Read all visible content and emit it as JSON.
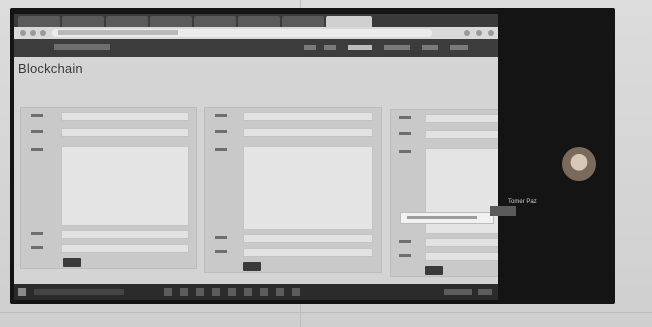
{
  "page": {
    "title": "Blockchain"
  },
  "presenter": {
    "name": "Tomer Paz"
  },
  "colors": {
    "monitor_frame": "#141414",
    "navbar": "#3c3c3c",
    "page_bg": "#d4d4d4",
    "button": "#3a3a3a"
  }
}
